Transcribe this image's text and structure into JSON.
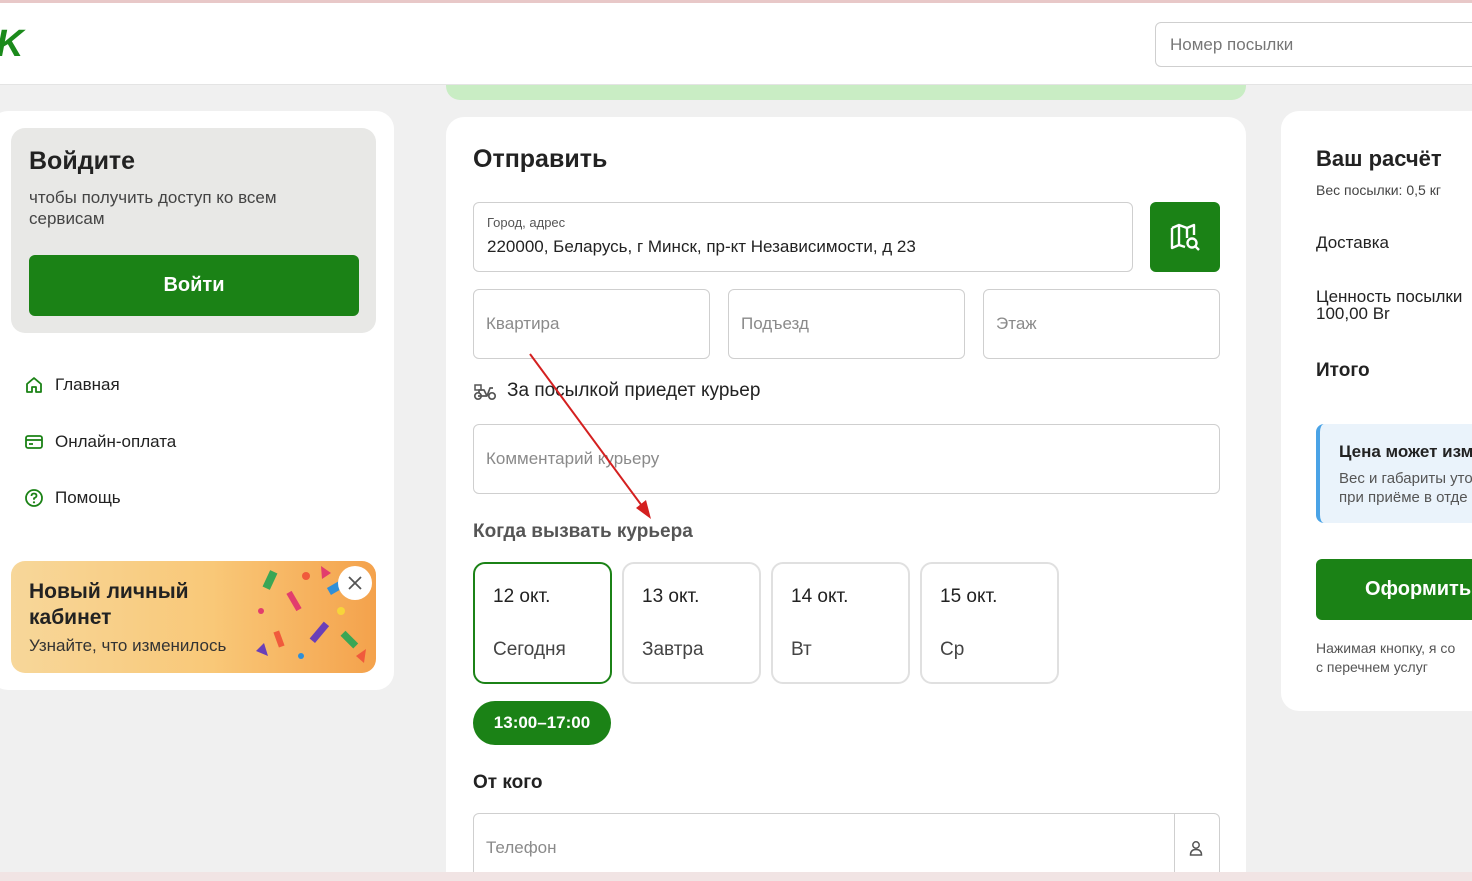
{
  "header": {
    "logo_text": "K",
    "track_placeholder": "Номер посылки"
  },
  "sidebar": {
    "login_title": "Войдите",
    "login_subtitle": "чтобы получить доступ ко всем сервисам",
    "login_button": "Войти",
    "nav": [
      {
        "label": "Главная",
        "icon": "home-icon"
      },
      {
        "label": "Онлайн-оплата",
        "icon": "card-icon"
      },
      {
        "label": "Помощь",
        "icon": "help-icon"
      }
    ],
    "promo_title": "Новый личный кабинет",
    "promo_subtitle": "Узнайте, что изменилось"
  },
  "form": {
    "title": "Отправить",
    "address_label": "Город, адрес",
    "address_value": "220000, Беларусь, г Минск, пр-кт Независимости, д 23",
    "apartment_placeholder": "Квартира",
    "entrance_placeholder": "Подъезд",
    "floor_placeholder": "Этаж",
    "courier_text": "За посылкой приедет курьер",
    "comment_placeholder": "Комментарий курьеру",
    "when_title": "Когда вызвать курьера",
    "days": [
      {
        "date": "12 окт.",
        "name": "Сегодня",
        "selected": true
      },
      {
        "date": "13 окт.",
        "name": "Завтра",
        "selected": false
      },
      {
        "date": "14 окт.",
        "name": "Вт",
        "selected": false
      },
      {
        "date": "15 окт.",
        "name": "Ср",
        "selected": false
      }
    ],
    "time_slot": "13:00–17:00",
    "from_title": "От кого",
    "phone_placeholder": "Телефон"
  },
  "summary": {
    "title": "Ваш расчёт",
    "weight": "Вес посылки: 0,5 кг",
    "delivery": "Доставка",
    "value_label": "Ценность посылки",
    "value_amount": "100,00 Br",
    "total": "Итого",
    "notice_title": "Цена может изм",
    "notice_line1": "Вес и габариты уто",
    "notice_line2": "при приёме в отде",
    "order_button": "Оформить",
    "note_line1": "Нажимая кнопку, я со",
    "note_line2": "с перечнем услуг"
  },
  "colors": {
    "brand_green": "#1b8216",
    "accent_blue": "#4aa3e6",
    "annotation_red": "#d42020"
  }
}
